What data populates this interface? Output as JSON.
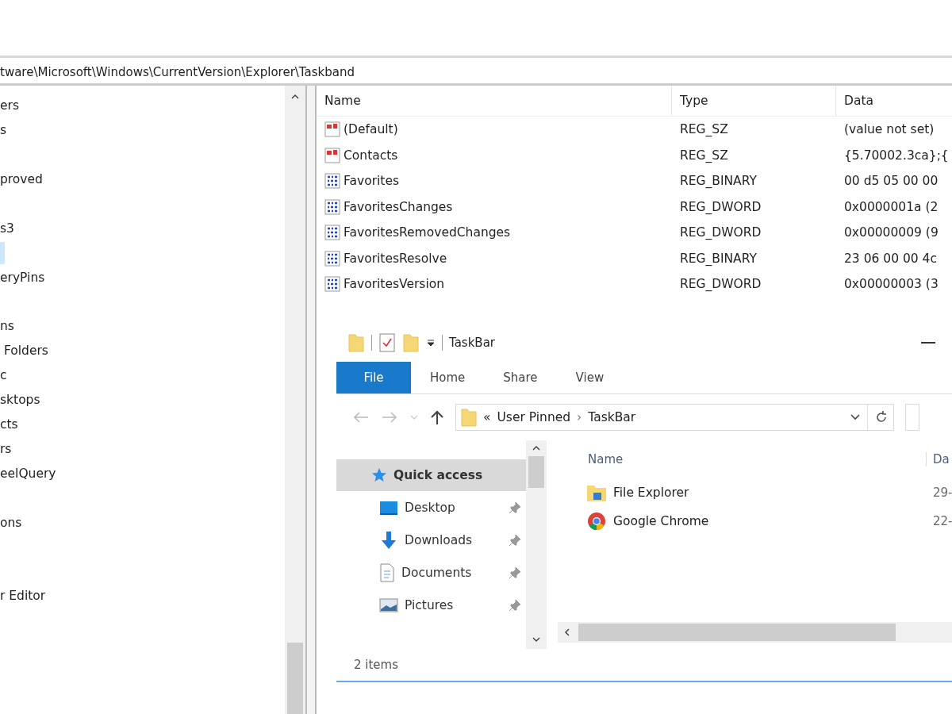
{
  "address_bar": {
    "path": "tware\\Microsoft\\Windows\\CurrentVersion\\Explorer\\Taskband"
  },
  "tree": {
    "items": [
      {
        "kind": "text",
        "label": "ers",
        "selected": false
      },
      {
        "kind": "text",
        "label": "s",
        "selected": false
      },
      {
        "kind": "offscreen",
        "selected": false
      },
      {
        "kind": "text",
        "label": "proved",
        "selected": false
      },
      {
        "kind": "offscreen",
        "selected": false
      },
      {
        "kind": "text",
        "label": "s3",
        "selected": false
      },
      {
        "kind": "offscreen",
        "selected": true
      },
      {
        "kind": "text",
        "label": "eryPins",
        "selected": false
      },
      {
        "kind": "offscreen",
        "selected": false
      },
      {
        "kind": "text",
        "label": "ns",
        "selected": false
      },
      {
        "kind": "text",
        "label": " Folders",
        "selected": false
      },
      {
        "kind": "text",
        "label": "c",
        "selected": false
      },
      {
        "kind": "text",
        "label": "sktops",
        "selected": false
      },
      {
        "kind": "text",
        "label": "cts",
        "selected": false
      },
      {
        "kind": "text",
        "label": "rs",
        "selected": false
      },
      {
        "kind": "text",
        "label": "eelQuery",
        "selected": false
      },
      {
        "kind": "offscreen",
        "selected": false
      },
      {
        "kind": "text",
        "label": "ons",
        "selected": false
      },
      {
        "kind": "offscreen",
        "selected": false
      },
      {
        "kind": "offscreen",
        "selected": false
      },
      {
        "kind": "text",
        "label": "r Editor",
        "selected": false
      }
    ]
  },
  "values_table": {
    "columns": [
      "Name",
      "Type",
      "Data"
    ],
    "rows": [
      {
        "kind": "string",
        "name": "(Default)",
        "type": "REG_SZ",
        "data": "(value not set)"
      },
      {
        "kind": "string",
        "name": "Contacts",
        "type": "REG_SZ",
        "data": "{5.70002.3ca};{"
      },
      {
        "kind": "binary",
        "name": "Favorites",
        "type": "REG_BINARY",
        "data": "00 d5 05 00 00"
      },
      {
        "kind": "binary",
        "name": "FavoritesChanges",
        "type": "REG_DWORD",
        "data": "0x0000001a (2"
      },
      {
        "kind": "binary",
        "name": "FavoritesRemovedChanges",
        "type": "REG_DWORD",
        "data": "0x00000009 (9"
      },
      {
        "kind": "binary",
        "name": "FavoritesResolve",
        "type": "REG_BINARY",
        "data": "23 06 00 00 4c"
      },
      {
        "kind": "binary",
        "name": "FavoritesVersion",
        "type": "REG_DWORD",
        "data": "0x00000003 (3"
      }
    ]
  },
  "explorer": {
    "title": "TaskBar",
    "tabs": [
      {
        "label": "File",
        "selected": true
      },
      {
        "label": "Home",
        "selected": false
      },
      {
        "label": "Share",
        "selected": false
      },
      {
        "label": "View",
        "selected": false
      }
    ],
    "breadcrumb": {
      "overflow": "«",
      "segments": [
        "User Pinned",
        "TaskBar"
      ],
      "separator": "›"
    },
    "nav": [
      {
        "kind": "quick",
        "label": "Quick access",
        "selected": true,
        "pinned": false
      },
      {
        "kind": "desktop",
        "label": "Desktop",
        "selected": false,
        "pinned": true
      },
      {
        "kind": "downloads",
        "label": "Downloads",
        "selected": false,
        "pinned": true
      },
      {
        "kind": "documents",
        "label": "Documents",
        "selected": false,
        "pinned": true
      },
      {
        "kind": "pictures",
        "label": "Pictures",
        "selected": false,
        "pinned": true
      }
    ],
    "columns": [
      "Name",
      "Da"
    ],
    "files": [
      {
        "kind": "explorer",
        "name": "File Explorer",
        "date": "29-"
      },
      {
        "kind": "chrome",
        "name": "Google Chrome",
        "date": "22-"
      }
    ],
    "status": "2 items"
  }
}
